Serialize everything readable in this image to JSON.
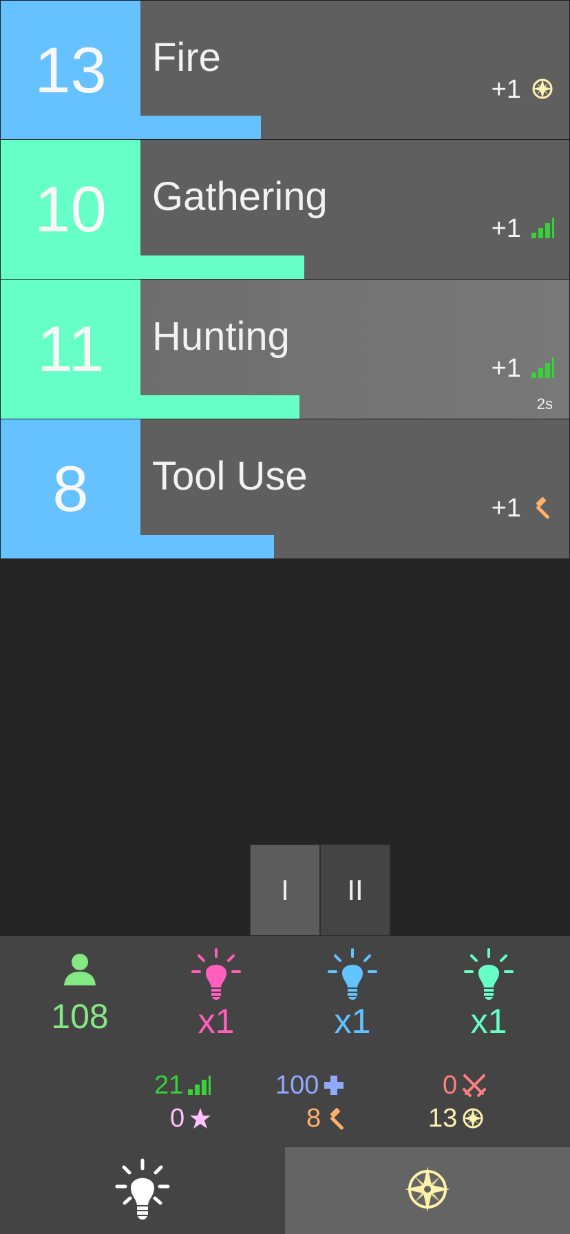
{
  "skills": [
    {
      "level": "13",
      "name": "Fire",
      "bonus": "+1",
      "bonus_icon": "compass-icon",
      "level_color": "#66c2ff",
      "progress": 0.28,
      "progress_color": "#66c2ff",
      "timer": "",
      "active": false
    },
    {
      "level": "10",
      "name": "Gathering",
      "bonus": "+1",
      "bonus_icon": "signal-bars-icon",
      "level_color": "#66ffc8",
      "progress": 0.38,
      "progress_color": "#66ffc8",
      "timer": "",
      "active": false
    },
    {
      "level": "11",
      "name": "Hunting",
      "bonus": "+1",
      "bonus_icon": "signal-bars-icon",
      "level_color": "#66ffc8",
      "progress": 0.37,
      "progress_color": "#66ffc8",
      "timer": "2s",
      "active": true
    },
    {
      "level": "8",
      "name": "Tool Use",
      "bonus": "+1",
      "bonus_icon": "hammer-icon",
      "level_color": "#66c2ff",
      "progress": 0.31,
      "progress_color": "#66c2ff",
      "timer": "",
      "active": false
    }
  ],
  "speed_controls": {
    "one": "I",
    "two": "II"
  },
  "stats": {
    "population": {
      "value": "108",
      "icon": "person-icon",
      "color": "#84e884"
    },
    "multipliers": [
      {
        "value": "x1",
        "icon": "lightbulb-icon",
        "color": "#ff5fbd"
      },
      {
        "value": "x1",
        "icon": "lightbulb-icon",
        "color": "#62c4ff"
      },
      {
        "value": "x1",
        "icon": "lightbulb-icon",
        "color": "#66ffc8"
      }
    ],
    "secondary": [
      {
        "value": "21",
        "icon": "signal-bars-icon",
        "color": "#39d239"
      },
      {
        "value": "100",
        "icon": "plus-icon",
        "color": "#91a9ff"
      },
      {
        "value": "0",
        "icon": "crossed-swords-icon",
        "color": "#ff7f7f"
      },
      {
        "value": "0",
        "icon": "star-icon",
        "color": "#ffc2ff"
      },
      {
        "value": "8",
        "icon": "hammer-icon",
        "color": "#ffb06b"
      },
      {
        "value": "13",
        "icon": "compass-icon",
        "color": "#fff2b0"
      }
    ]
  },
  "nav": {
    "left_icon": "lightbulb-icon",
    "right_icon": "compass-icon"
  }
}
